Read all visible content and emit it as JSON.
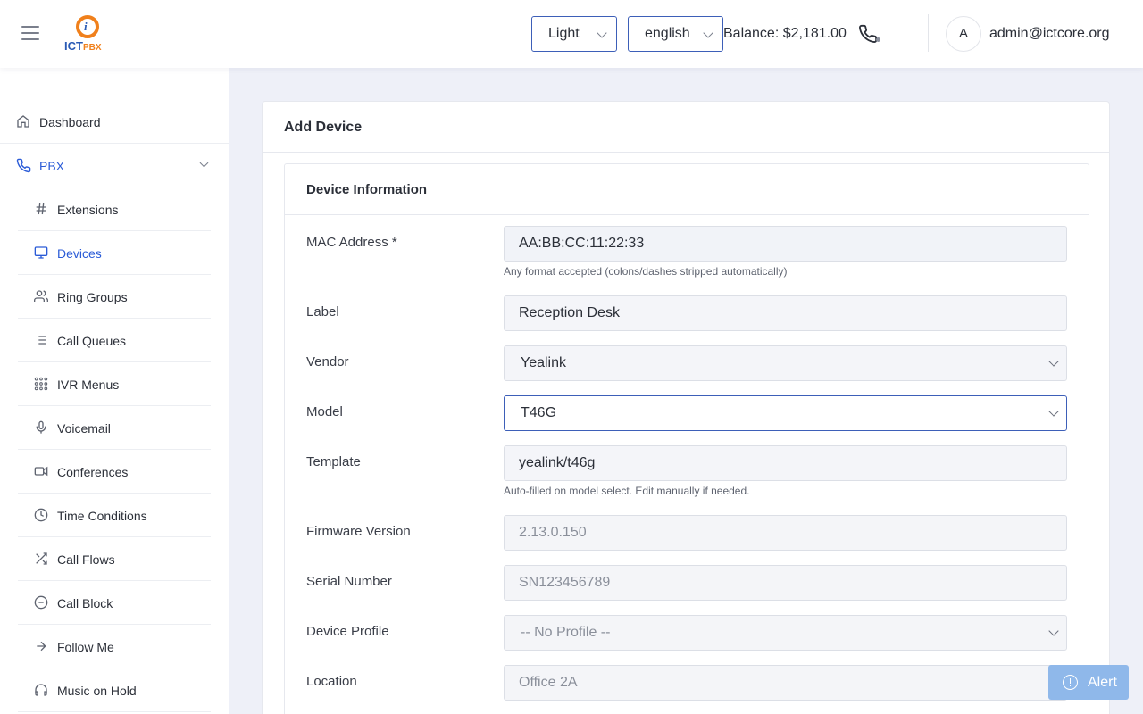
{
  "header": {
    "logo_text": "ICT",
    "logo_suffix": "PBX",
    "theme_select": "Light",
    "language_select": "english",
    "balance": "Balance: $2,181.00",
    "avatar_initial": "A",
    "user_email": "admin@ictcore.org"
  },
  "sidebar": {
    "items": [
      {
        "label": "Dashboard",
        "icon": "home-icon"
      },
      {
        "label": "PBX",
        "icon": "phone-icon",
        "active": true
      },
      {
        "label": "Extensions",
        "icon": "hash-icon"
      },
      {
        "label": "Devices",
        "icon": "monitor-icon",
        "active": true
      },
      {
        "label": "Ring Groups",
        "icon": "users-icon"
      },
      {
        "label": "Call Queues",
        "icon": "list-icon"
      },
      {
        "label": "IVR Menus",
        "icon": "grid-icon"
      },
      {
        "label": "Voicemail",
        "icon": "mic-icon"
      },
      {
        "label": "Conferences",
        "icon": "video-icon"
      },
      {
        "label": "Time Conditions",
        "icon": "clock-icon"
      },
      {
        "label": "Call Flows",
        "icon": "shuffle-icon"
      },
      {
        "label": "Call Block",
        "icon": "minus-circle-icon"
      },
      {
        "label": "Follow Me",
        "icon": "arrow-right-icon"
      },
      {
        "label": "Music on Hold",
        "icon": "headphones-icon"
      }
    ]
  },
  "main": {
    "card_title": "Add Device",
    "section_title": "Device Information",
    "fields": {
      "mac_label": "MAC Address *",
      "mac_value": "AA:BB:CC:11:22:33",
      "mac_hint": "Any format accepted (colons/dashes stripped automatically)",
      "label_label": "Label",
      "label_value": "Reception Desk",
      "vendor_label": "Vendor",
      "vendor_value": "Yealink",
      "model_label": "Model",
      "model_value": "T46G",
      "template_label": "Template",
      "template_value": "yealink/t46g",
      "template_hint": "Auto-filled on model select. Edit manually if needed.",
      "firmware_label": "Firmware Version",
      "firmware_placeholder": "2.13.0.150",
      "serial_label": "Serial Number",
      "serial_placeholder": "SN123456789",
      "profile_label": "Device Profile",
      "profile_value": "-- No Profile --",
      "location_label": "Location",
      "location_placeholder": "Office 2A"
    }
  },
  "alert_button": "Alert",
  "colors": {
    "accent": "#2a5bd7",
    "border_focus": "#3d5fb8",
    "logo_orange": "#f0801c",
    "alert_bg": "#8fb8ea"
  }
}
